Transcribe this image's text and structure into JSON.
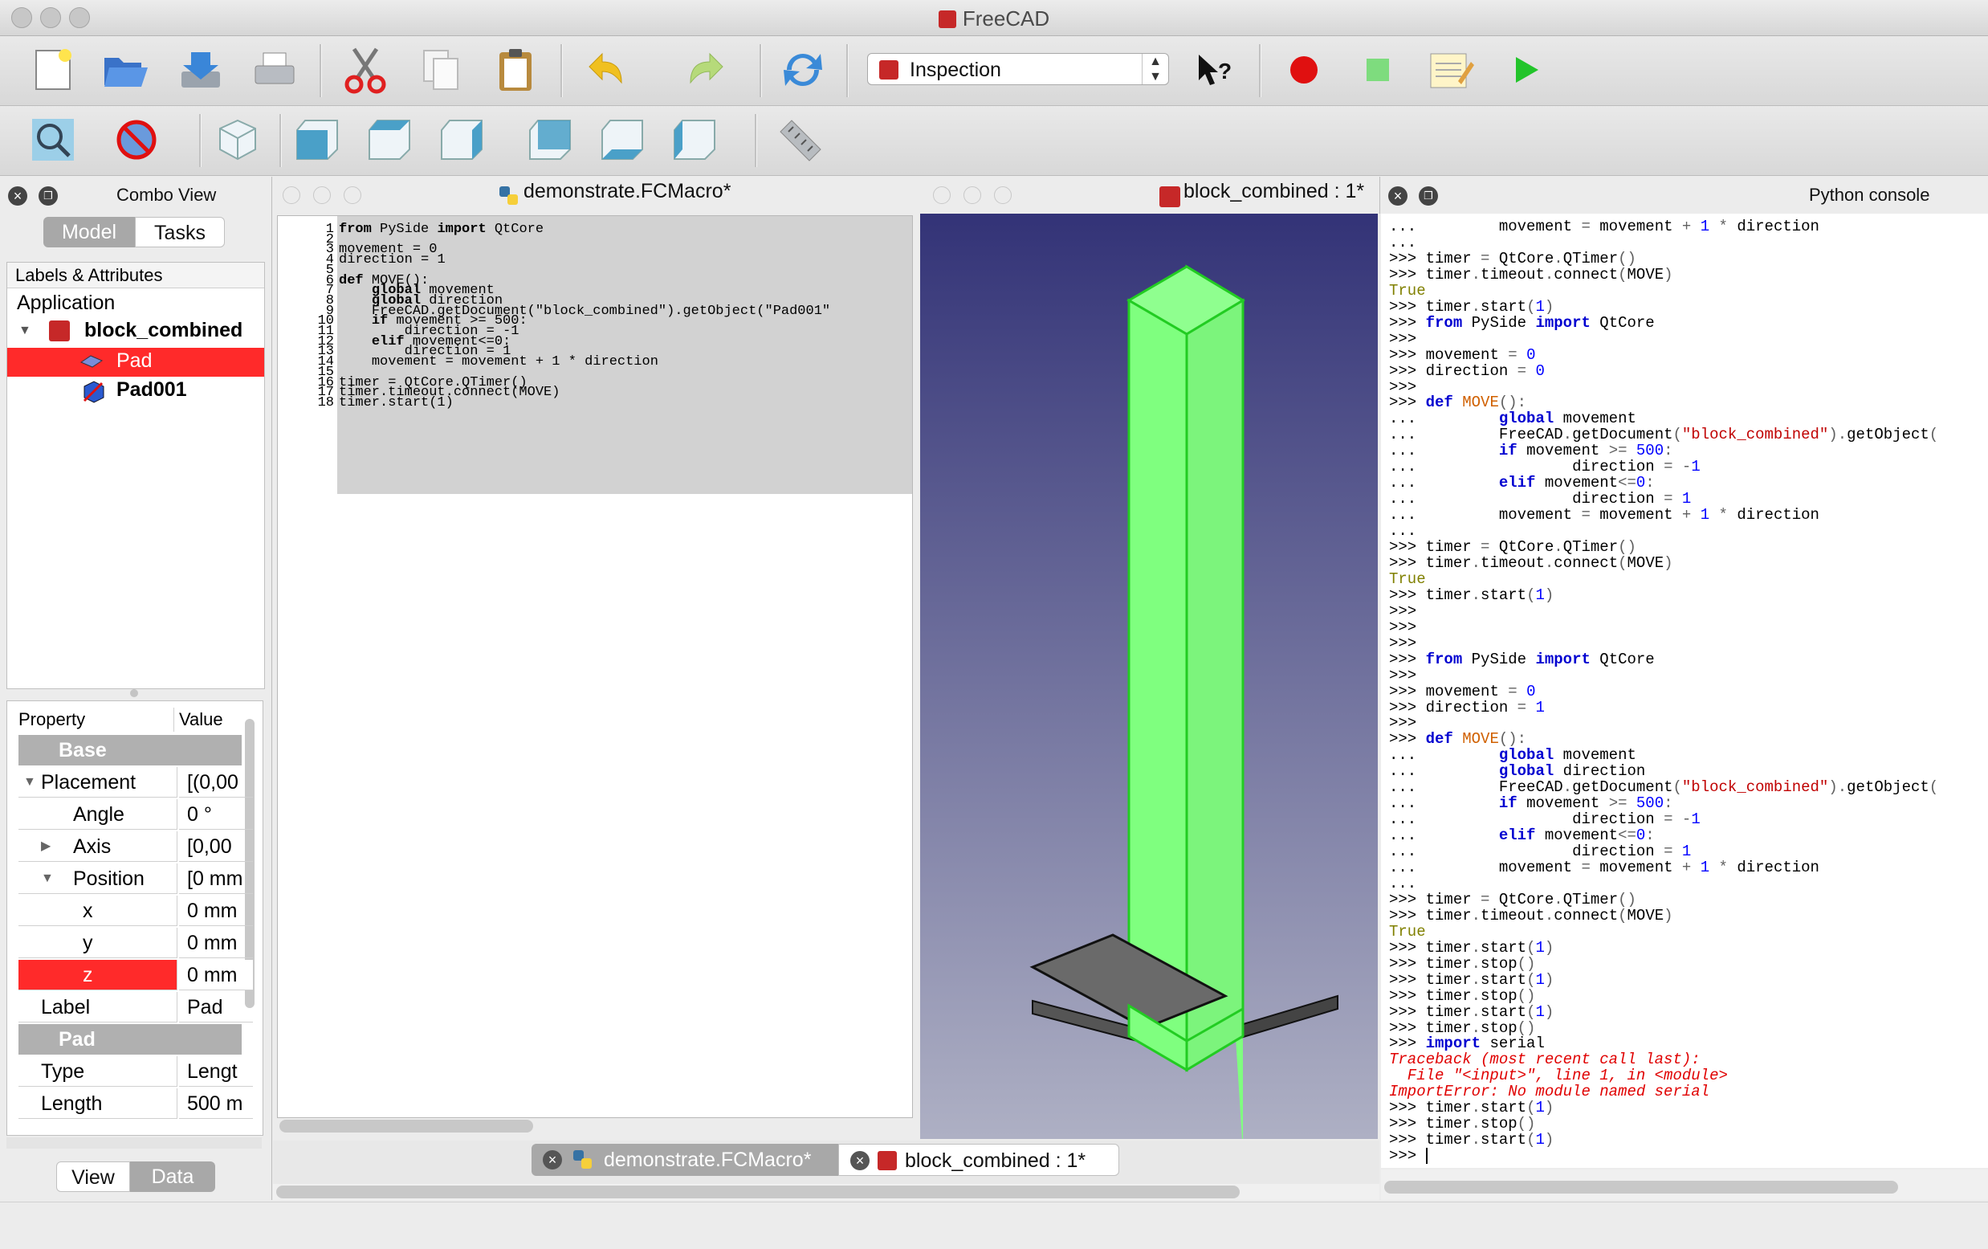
{
  "window": {
    "title": "FreeCAD"
  },
  "toolbar": {
    "workbench": "Inspection"
  },
  "combo_view": {
    "title": "Combo View",
    "tabs": [
      "Model",
      "Tasks"
    ],
    "tree_header": "Labels & Attributes",
    "tree": {
      "root": "Application",
      "document": "block_combined",
      "items": [
        "Pad",
        "Pad001"
      ]
    },
    "property_headers": [
      "Property",
      "Value"
    ],
    "property_rows": [
      {
        "type": "group",
        "label": "Base"
      },
      {
        "type": "row",
        "label": "Placement",
        "value": "[(0,00",
        "indent": 0,
        "arrow": "open"
      },
      {
        "type": "row",
        "label": "Angle",
        "value": "0 °",
        "indent": 1
      },
      {
        "type": "row",
        "label": "Axis",
        "value": "[0,00",
        "indent": 1,
        "arrow": "closed"
      },
      {
        "type": "row",
        "label": "Position",
        "value": "[0 mm",
        "indent": 1,
        "arrow": "open"
      },
      {
        "type": "row",
        "label": "x",
        "value": "0 mm",
        "indent": 2
      },
      {
        "type": "row",
        "label": "y",
        "value": "0 mm",
        "indent": 2
      },
      {
        "type": "row",
        "label": "z",
        "value": "0 mm",
        "indent": 2,
        "selected": true
      },
      {
        "type": "row",
        "label": "Label",
        "value": "Pad",
        "indent": 0
      },
      {
        "type": "group",
        "label": "Pad"
      },
      {
        "type": "row",
        "label": "Type",
        "value": "Lengt",
        "indent": 0
      },
      {
        "type": "row",
        "label": "Length",
        "value": "500 m",
        "indent": 0
      }
    ],
    "bottom_tabs": [
      "View",
      "Data"
    ]
  },
  "editor": {
    "title": "demonstrate.FCMacro*",
    "lines": [
      "from PySide import QtCore",
      "",
      "movement = 0",
      "direction = 1",
      "",
      "def MOVE():",
      "    global movement",
      "    global direction",
      "    FreeCAD.getDocument(\"block_combined\").getObject(\"Pad001\"",
      "    if movement >= 500:",
      "        direction = -1",
      "    elif movement<=0:",
      "        direction = 1",
      "    movement = movement + 1 * direction",
      "",
      "timer = QtCore.QTimer()",
      "timer.timeout.connect(MOVE)",
      "timer.start(1)"
    ]
  },
  "viewer": {
    "title": "block_combined : 1*"
  },
  "mdi_tabs": [
    "demonstrate.FCMacro*",
    "block_combined : 1*"
  ],
  "console": {
    "title": "Python console",
    "lines": [
      "...         movement = movement + 1 * direction",
      "...",
      ">>> timer = QtCore.QTimer()",
      ">>> timer.timeout.connect(MOVE)",
      "True",
      ">>> timer.start(1)",
      ">>> from PySide import QtCore",
      ">>>",
      ">>> movement = 0",
      ">>> direction = 0",
      ">>>",
      ">>> def MOVE():",
      "...         global movement",
      "...         FreeCAD.getDocument(\"block_combined\").getObject(\"",
      "...         if movement >= 500:",
      "...                 direction = -1",
      "...         elif movement<=0:",
      "...                 direction = 1",
      "...         movement = movement + 1 * direction",
      "...",
      ">>> timer = QtCore.QTimer()",
      ">>> timer.timeout.connect(MOVE)",
      "True",
      ">>> timer.start(1)",
      ">>>",
      ">>>",
      ">>>",
      ">>> from PySide import QtCore",
      ">>>",
      ">>> movement = 0",
      ">>> direction = 1",
      ">>>",
      ">>> def MOVE():",
      "...         global movement",
      "...         global direction",
      "...         FreeCAD.getDocument(\"block_combined\").getObject(\"",
      "...         if movement >= 500:",
      "...                 direction = -1",
      "...         elif movement<=0:",
      "...                 direction = 1",
      "...         movement = movement + 1 * direction",
      "...",
      ">>> timer = QtCore.QTimer()",
      ">>> timer.timeout.connect(MOVE)",
      "True",
      ">>> timer.start(1)",
      ">>> timer.stop()",
      ">>> timer.start(1)",
      ">>> timer.stop()",
      ">>> timer.start(1)",
      ">>> timer.stop()",
      ">>> import serial",
      "Traceback (most recent call last):",
      "  File \"<input>\", line 1, in <module>",
      "ImportError: No module named serial",
      ">>> timer.start(1)",
      ">>> timer.stop()",
      ">>> timer.start(1)",
      ">>> "
    ]
  },
  "colors": {
    "selection": "#ff2a2a",
    "solid_green": "#7fff7f",
    "edge_green": "#22cc22",
    "viewport_top": "#333377",
    "viewport_bottom": "#aeb0c4"
  }
}
